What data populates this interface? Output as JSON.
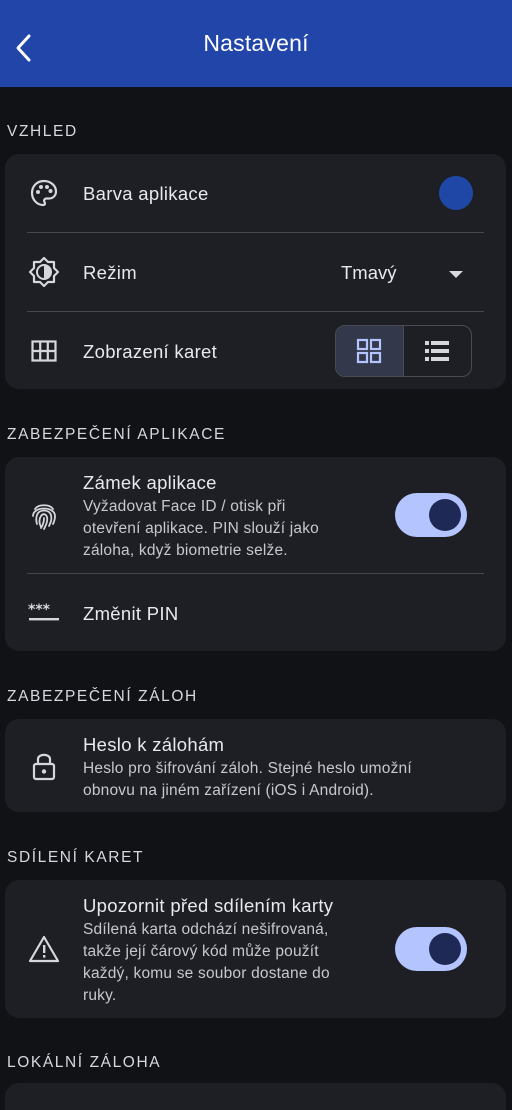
{
  "appbar": {
    "title": "Nastavení"
  },
  "sections": {
    "appearance": {
      "header": "VZHLED",
      "app_color": {
        "label": "Barva aplikace",
        "color": "#1f47a6"
      },
      "mode": {
        "label": "Režim",
        "value": "Tmavý"
      },
      "card_view": {
        "label": "Zobrazení karet",
        "selected": "grid"
      }
    },
    "app_security": {
      "header": "ZABEZPEČENÍ APLIKACE",
      "app_lock": {
        "label": "Zámek aplikace",
        "sub1": "Vyžadovat Face ID / otisk při",
        "sub2": "otevření aplikace. PIN slouží jako",
        "sub3": "záloha, když biometrie selže.",
        "enabled": true
      },
      "change_pin": {
        "label": "Změnit PIN"
      }
    },
    "backup_security": {
      "header": "ZABEZPEČENÍ ZÁLOH",
      "backup_password": {
        "label": "Heslo k zálohám",
        "sub1": "Heslo pro šifrování záloh. Stejné heslo umožní",
        "sub2": "obnovu na jiném zařízení (iOS i Android)."
      }
    },
    "card_sharing": {
      "header": "SDÍLENÍ KARET",
      "warn_before_share": {
        "label": "Upozornit před sdílením karty",
        "sub1": "Sdílená karta odchází nešifrovaná,",
        "sub2": "takže její čárový kód může použít",
        "sub3": "každý, komu se soubor dostane do",
        "sub4": "ruky.",
        "enabled": true
      }
    },
    "local_backup": {
      "header": "LOKÁLNÍ ZÁLOHA"
    }
  },
  "colors": {
    "appbar": "#2145a8",
    "background": "#111216",
    "card": "#1e1f24",
    "toggle_track": "#b3c4ff",
    "toggle_knob": "#1e2a55"
  }
}
